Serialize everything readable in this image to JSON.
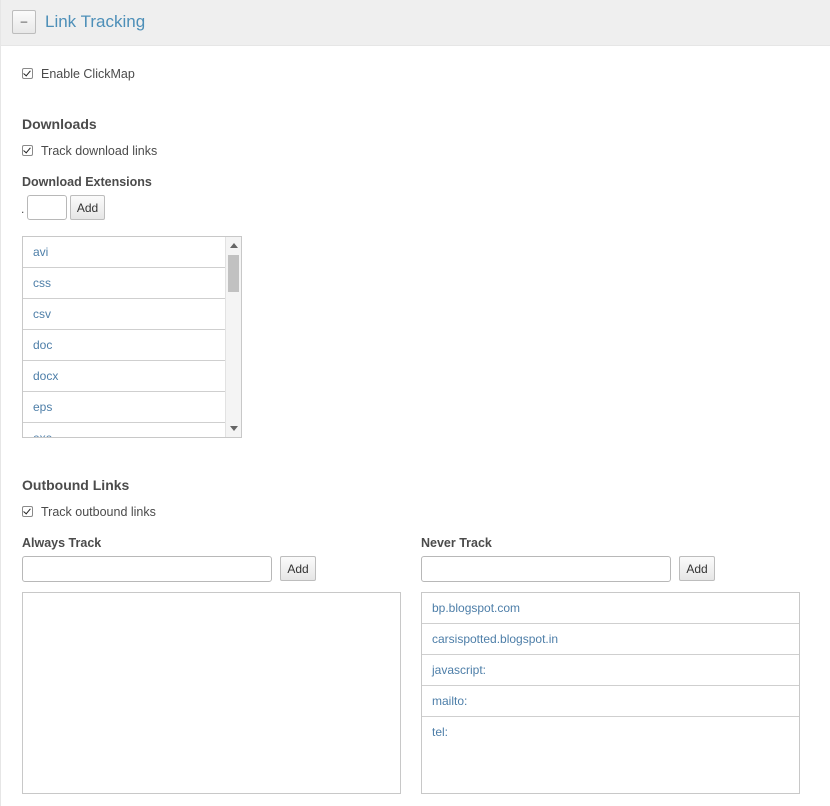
{
  "header": {
    "collapse_symbol": "–",
    "title": "Link Tracking"
  },
  "clickmap": {
    "label": "Enable ClickMap",
    "checked": true
  },
  "downloads": {
    "heading": "Downloads",
    "track_label": "Track download links",
    "track_checked": true,
    "extensions_label": "Download Extensions",
    "dot_prefix": ".",
    "input_value": "",
    "add_label": "Add",
    "extensions": [
      "avi",
      "css",
      "csv",
      "doc",
      "docx",
      "eps",
      "exe"
    ]
  },
  "outbound": {
    "heading": "Outbound Links",
    "track_label": "Track outbound links",
    "track_checked": true,
    "always_track": {
      "label": "Always Track",
      "input_value": "",
      "add_label": "Add",
      "items": []
    },
    "never_track": {
      "label": "Never Track",
      "input_value": "",
      "add_label": "Add",
      "items": [
        "bp.blogspot.com",
        "carsispotted.blogspot.in",
        "javascript:",
        "mailto:",
        "tel:"
      ]
    }
  },
  "colors": {
    "title_blue": "#4d8fb8",
    "link_blue": "#4d7ea8",
    "header_bg": "#efefef"
  }
}
